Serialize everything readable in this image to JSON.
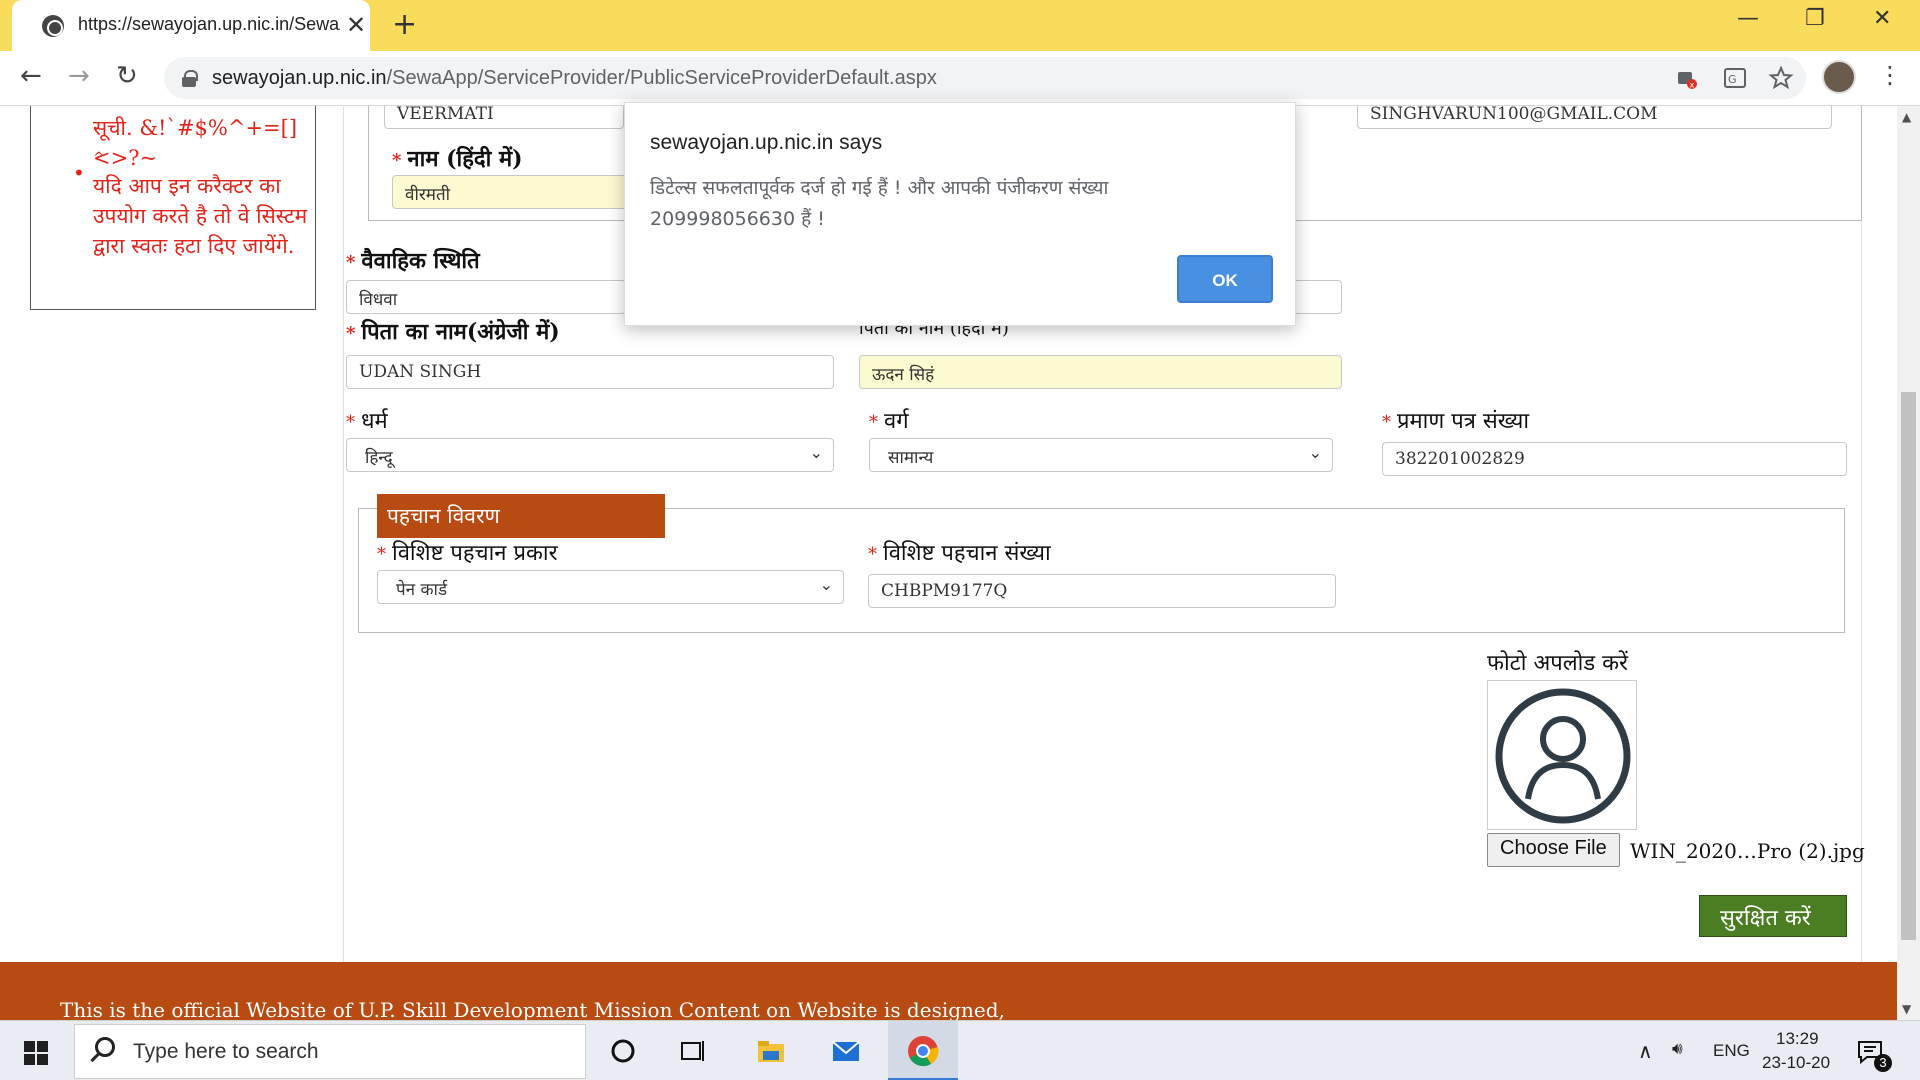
{
  "browser": {
    "tab_title": "https://sewayojan.up.nic.in/SewaApp/ServiceProvider/PublicServiceProviderDefault.aspx",
    "tab_close": "✕",
    "new_tab": "+",
    "window_minimize": "—",
    "window_restore": "❐",
    "window_close": "✕",
    "back": "←",
    "forward": "→",
    "reload": "↻",
    "url_host": "sewayojan.up.nic.in",
    "url_path": "/SewaApp/ServiceProvider/PublicServiceProviderDefault.aspx",
    "menu": "⋮"
  },
  "notice": {
    "line1": "सूची. &!`#$%^+=[]<>?~",
    "line2": "^",
    "bullet": "•",
    "bullet_text": "यदि आप इन करैक्टर का उपयोग करते है तो वे सिस्टम द्वारा स्वतः हटा दिए जायेंगे."
  },
  "form": {
    "name_en_value": "VEERMATI",
    "email_value": "SINGHVARUN100@GMAIL.COM",
    "name_hi_label": "नाम (हिंदी में)",
    "name_hi_value": "वीरमती",
    "marital_label": "वैवाहिक स्थिति",
    "marital_value": "विधवा",
    "father_en_label": "पिता का नाम(अंग्रेजी में)",
    "father_en_value": "UDAN SINGH",
    "father_hi_label": "पिता का नाम (हिंदी में)",
    "father_hi_value": "ऊदन सिहं",
    "religion_label": "धर्म",
    "religion_value": "हिन्दू",
    "category_label": "वर्ग",
    "category_value": "सामान्य",
    "certificate_label": "प्रमाण पत्र संख्या",
    "certificate_value": "382201002829",
    "section_title": "पहचान विवरण",
    "id_type_label": "विशिष्ट पहचान प्रकार",
    "id_type_value": "पेन कार्ड",
    "id_number_label": "विशिष्ट पहचान संख्या",
    "id_number_value": "CHBPM9177Q",
    "photo_label": "फोटो अपलोड करें",
    "choose_file": "Choose File",
    "file_name": "WIN_2020…Pro (2).jpg",
    "save_button": "सुरक्षित करें",
    "required_mark": "*"
  },
  "footer": {
    "text": "This is the official Website of U.P. Skill Development Mission Content on Website is designed,"
  },
  "dialog": {
    "title": "sewayojan.up.nic.in says",
    "message": "डिटेल्स सफलतापूर्वक दर्ज हो गई हैं ! और आपकी पंजीकरण संख्या 209998056630 हैं !",
    "ok": "OK"
  },
  "taskbar": {
    "search_placeholder": "Type here to search",
    "language": "ENG",
    "time": "13:29",
    "date": "23-10-20",
    "notification_count": "3",
    "tray_up": "∧",
    "volume": "🔊︎"
  }
}
